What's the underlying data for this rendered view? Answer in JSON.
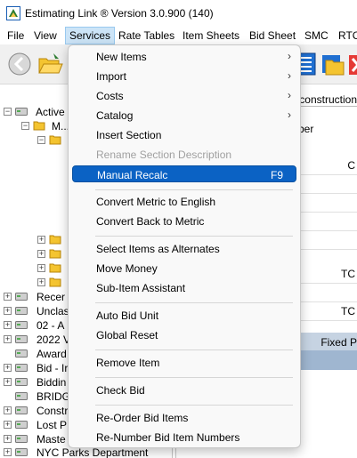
{
  "window": {
    "title": "Estimating Link ® Version   3.0.900 (140)"
  },
  "menubar": {
    "items": [
      "File",
      "View",
      "Services",
      "Rate Tables",
      "Item Sheets",
      "Bid Sheet",
      "SMC",
      "RTC"
    ],
    "active": "Services"
  },
  "toolbar": {
    "buttons": [
      "back-icon",
      "open-folder-icon",
      "grid-icon",
      "folder-icon",
      "close-icon"
    ]
  },
  "tree": {
    "rows": [
      {
        "label": "Active"
      },
      {
        "label": "M..."
      },
      {
        "label": ""
      },
      {
        "label": ""
      },
      {
        "label": ""
      },
      {
        "label": ""
      },
      {
        "label": ""
      },
      {
        "label": "Recer"
      },
      {
        "label": "Unclas"
      },
      {
        "label": "02 - A"
      },
      {
        "label": "2022 V"
      },
      {
        "label": "Award"
      },
      {
        "label": "Bid - Ir"
      },
      {
        "label": "Biddin"
      },
      {
        "label": "BRIDG"
      },
      {
        "label": "Constr"
      },
      {
        "label": "Lost P"
      },
      {
        "label": "Maste"
      },
      {
        "label": "NYC Parks Department"
      }
    ]
  },
  "right_panel": {
    "tab_text": "econstruction",
    "header": "ber",
    "cells": [
      "C",
      "",
      "",
      "",
      "",
      "TC",
      "",
      "TC"
    ],
    "fixed_label": "Fixed P"
  },
  "menu": {
    "items": [
      {
        "label": "New Items",
        "submenu": true,
        "disabled": false
      },
      {
        "label": "Import",
        "submenu": true,
        "disabled": false
      },
      {
        "label": "Costs",
        "submenu": true,
        "disabled": false
      },
      {
        "label": "Catalog",
        "submenu": true,
        "disabled": false
      },
      {
        "label": "Insert Section",
        "submenu": false,
        "disabled": false
      },
      {
        "label": "Rename Section Description",
        "submenu": false,
        "disabled": true
      },
      {
        "label": "Manual Recalc",
        "shortcut": "F9",
        "highlight": true
      },
      {
        "label": "Convert Metric to English"
      },
      {
        "label": "Convert Back to Metric"
      },
      {
        "label": "Select Items as Alternates"
      },
      {
        "label": "Move Money"
      },
      {
        "label": "Sub-Item Assistant"
      },
      {
        "label": "Auto Bid Unit"
      },
      {
        "label": "Global Reset"
      },
      {
        "label": "Remove Item"
      },
      {
        "label": "Check Bid"
      },
      {
        "label": "Re-Order Bid Items"
      },
      {
        "label": "Re-Number Bid Item Numbers"
      }
    ],
    "submenu_arrow": "›",
    "colors": {
      "highlight": "#0b62c4"
    }
  }
}
